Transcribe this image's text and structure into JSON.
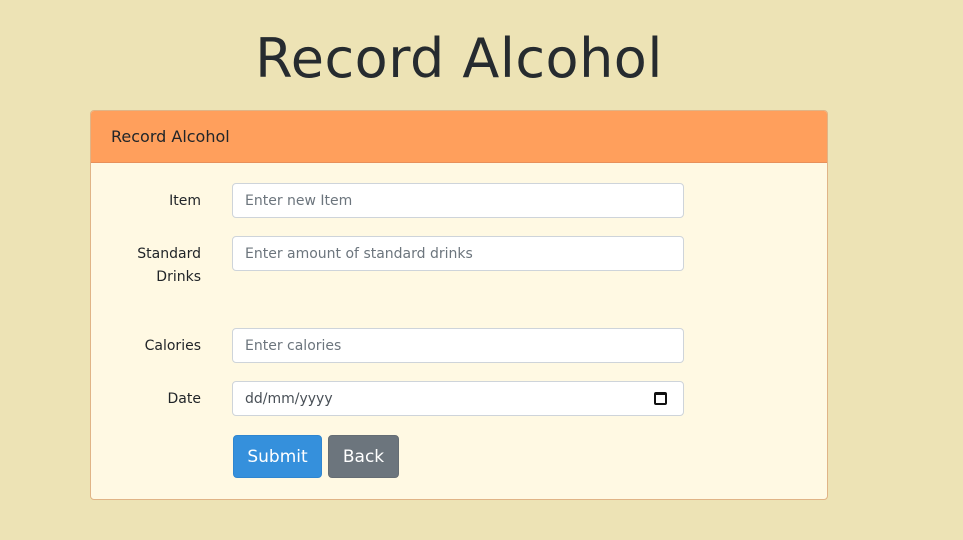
{
  "page": {
    "title": "Record Alcohol"
  },
  "card": {
    "header": "Record Alcohol"
  },
  "form": {
    "item": {
      "label": "Item",
      "placeholder": "Enter new Item"
    },
    "standard_drinks": {
      "label_line1": "Standard",
      "label_line2": "Drinks",
      "placeholder": "Enter amount of standard drinks"
    },
    "calories": {
      "label": "Calories",
      "placeholder": "Enter calories"
    },
    "date": {
      "label": "Date",
      "value": "dd/mm/yyyy"
    }
  },
  "buttons": {
    "submit": "Submit",
    "back": "Back"
  },
  "colors": {
    "background": "#ede3b5",
    "card_header": "#ff9f5c",
    "card_body": "#fff9e3",
    "submit": "#3590dc",
    "back": "#6c757d"
  },
  "icons": {
    "date_picker": "calendar-icon"
  }
}
